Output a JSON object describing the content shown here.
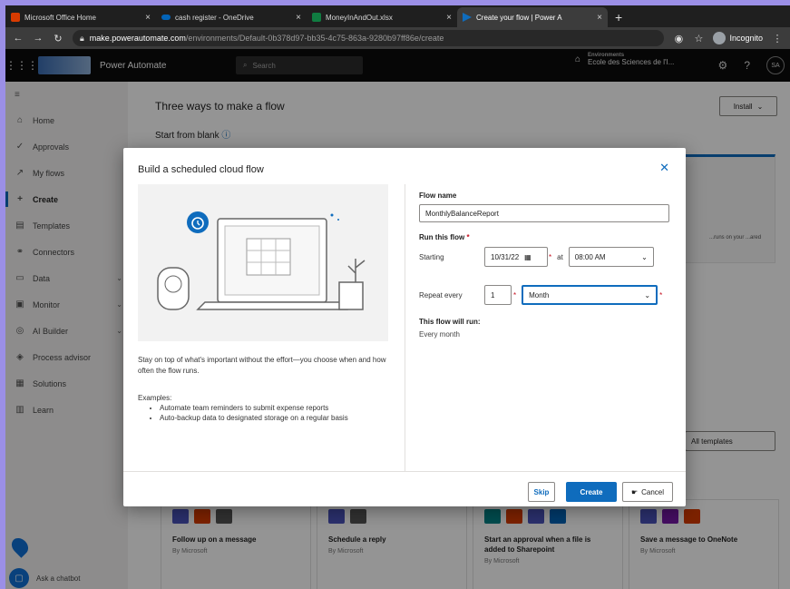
{
  "browser": {
    "tabs": [
      {
        "label": "Microsoft Office Home",
        "color": "#d83b01",
        "active": false
      },
      {
        "label": "cash register - OneDrive",
        "color": "#0364b8",
        "active": false
      },
      {
        "label": "MoneyInAndOut.xlsx",
        "color": "#107c41",
        "active": false
      },
      {
        "label": "Create your flow | Power A",
        "color": "#0f6cbd",
        "active": true
      }
    ],
    "new_tab": "+",
    "url_host": "make.powerautomate.com",
    "url_path": "/environments/Default-0b378d97-bb35-4c75-863a-9280b97ff86e/create",
    "incognito": "Incognito"
  },
  "appbar": {
    "app_name": "Power Automate",
    "search_placeholder": "Search",
    "env_label": "Environments",
    "env_value": "Ecole des Sciences de l'I...",
    "avatar": "SA"
  },
  "sidebar": {
    "items": [
      {
        "label": "Home",
        "icon": "⌂",
        "chev": ""
      },
      {
        "label": "Approvals",
        "icon": "✓",
        "chev": ""
      },
      {
        "label": "My flows",
        "icon": "↗",
        "chev": ""
      },
      {
        "label": "Create",
        "icon": "+",
        "chev": "",
        "active": true
      },
      {
        "label": "Templates",
        "icon": "▤",
        "chev": ""
      },
      {
        "label": "Connectors",
        "icon": "⚭",
        "chev": ""
      },
      {
        "label": "Data",
        "icon": "▭",
        "chev": "⌄"
      },
      {
        "label": "Monitor",
        "icon": "▣",
        "chev": "⌄"
      },
      {
        "label": "AI Builder",
        "icon": "◎",
        "chev": "⌄"
      },
      {
        "label": "Process advisor",
        "icon": "◈",
        "chev": ""
      },
      {
        "label": "Solutions",
        "icon": "▦",
        "chev": ""
      },
      {
        "label": "Learn",
        "icon": "▥",
        "chev": ""
      }
    ],
    "chatbot": "Ask a chatbot"
  },
  "main": {
    "title": "Three ways to make a flow",
    "start_blank": "Start from blank",
    "install": "Install",
    "all_templates": "All templates",
    "bg_card_text": "...runs on your ...ared",
    "templates": [
      {
        "title": "Follow up on a message",
        "by": "By Microsoft",
        "icons": [
          "#4b53bc",
          "#d83b01",
          "#555555"
        ]
      },
      {
        "title": "Schedule a reply",
        "by": "By Microsoft",
        "icons": [
          "#4b53bc",
          "#555555"
        ]
      },
      {
        "title": "Start an approval when a file is added to Sharepoint",
        "by": "By Microsoft",
        "icons": [
          "#038387",
          "#d83b01",
          "#4b53bc",
          "#0364b8"
        ]
      },
      {
        "title": "Save a message to OneNote",
        "by": "By Microsoft",
        "icons": [
          "#4b53bc",
          "#7719aa",
          "#d83b01"
        ]
      }
    ]
  },
  "modal": {
    "title": "Build a scheduled cloud flow",
    "description": "Stay on top of what's important without the effort—you choose when and how often the flow runs.",
    "examples_label": "Examples:",
    "examples": [
      "Automate team reminders to submit expense reports",
      "Auto-backup data to designated storage on a regular basis"
    ],
    "flow_name_label": "Flow name",
    "flow_name_value": "MonthlyBalanceReport",
    "run_label": "Run this flow",
    "starting_label": "Starting",
    "date_value": "10/31/22",
    "at_label": "at",
    "time_value": "08:00 AM",
    "repeat_label": "Repeat every",
    "repeat_count": "1",
    "repeat_unit": "Month",
    "will_run_label": "This flow will run:",
    "will_run_value": "Every month",
    "skip": "Skip",
    "create": "Create",
    "cancel": "Cancel"
  }
}
